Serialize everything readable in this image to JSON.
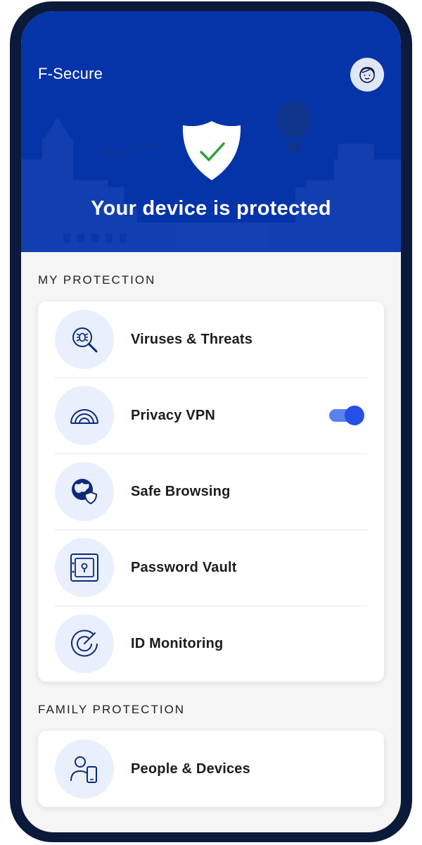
{
  "app": {
    "brand": "F-Secure",
    "status_title": "Your device is protected"
  },
  "colors": {
    "header_blue": "#0533A8",
    "accent_blue": "#2450E8",
    "icon_bg": "#E9EFFC",
    "frame": "#0B1A3A",
    "check_green": "#2E9D3E"
  },
  "icons": {
    "avatar": "user-avatar-icon",
    "shield": "shield-check-icon"
  },
  "my_protection": {
    "label": "MY PROTECTION",
    "items": [
      {
        "label": "Viruses & Threats",
        "icon": "virus-scan-icon"
      },
      {
        "label": "Privacy VPN",
        "icon": "vpn-signal-icon",
        "toggle_on": true
      },
      {
        "label": "Safe Browsing",
        "icon": "globe-shield-icon"
      },
      {
        "label": "Password Vault",
        "icon": "vault-icon"
      },
      {
        "label": "ID Monitoring",
        "icon": "radar-icon"
      }
    ]
  },
  "family_protection": {
    "label": "FAMILY PROTECTION",
    "items": [
      {
        "label": "People & Devices",
        "icon": "person-device-icon"
      }
    ]
  }
}
